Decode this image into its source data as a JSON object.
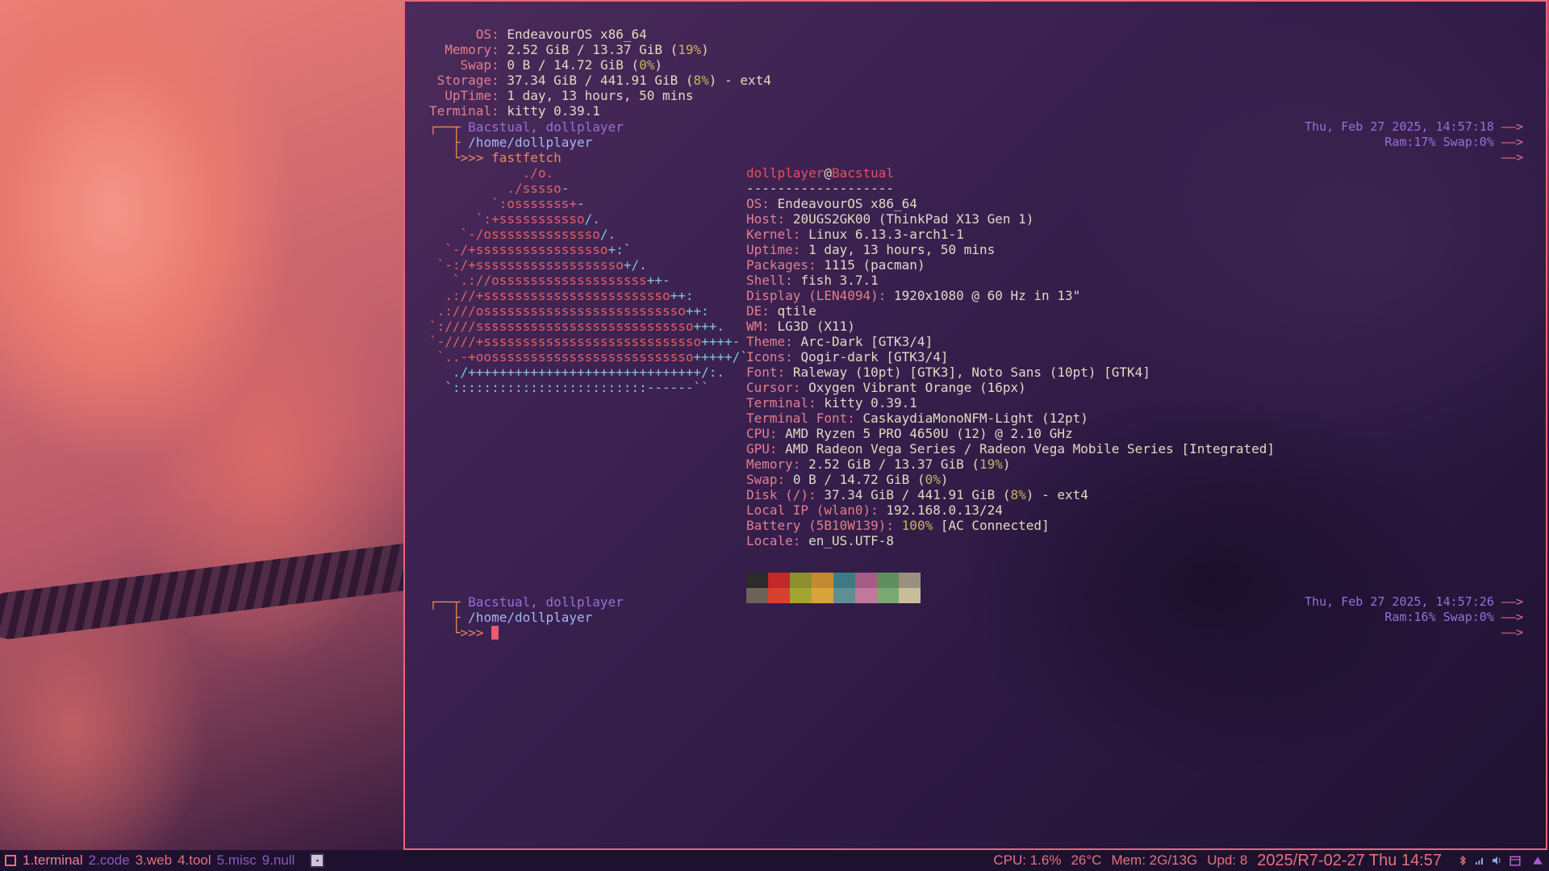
{
  "sysinfo_top": [
    {
      "label": "OS",
      "value": "EndeavourOS x86_64"
    },
    {
      "label": "Memory",
      "value_pre": "2.52 GiB / 13.37 GiB (",
      "value_pct": "19%",
      "value_post": ")"
    },
    {
      "label": "Swap",
      "value_pre": "0 B / 14.72 GiB (",
      "value_pct": "0%",
      "value_post": ")"
    },
    {
      "label": "Storage",
      "value_pre": "37.34 GiB / 441.91 GiB (",
      "value_pct": "8%",
      "value_post": ") - ext4"
    },
    {
      "label": "UpTime",
      "value": "1 day, 13 hours, 50 mins"
    },
    {
      "label": "Terminal",
      "value": "kitty 0.39.1"
    }
  ],
  "prompt1": {
    "user": "Bacstual, dollplayer",
    "path": "/home/dollplayer",
    "arrows": ">>>",
    "command": "fastfetch",
    "right_datetime": "Thu, Feb 27 2025, 14:57:18",
    "right_mem": "Ram:17% Swap:0%",
    "right_arrow": "——>"
  },
  "prompt2": {
    "user": "Bacstual, dollplayer",
    "path": "/home/dollplayer",
    "arrows": ">>>",
    "right_datetime": "Thu, Feb 27 2025, 14:57:26",
    "right_mem": "Ram:16% Swap:0%",
    "right_arrow": "——>"
  },
  "ascii_art": [
    {
      "red": "            ./o.",
      "blue": ""
    },
    {
      "red": "          ./sssso",
      "blue": "-"
    },
    {
      "red": "        `:osssssss+",
      "blue": "-"
    },
    {
      "red": "      `:+sssssssssso",
      "blue": "/."
    },
    {
      "red": "    `-/ossssssssssssso",
      "blue": "/."
    },
    {
      "red": "  `-/+sssssssssssssssso",
      "blue": "+:`"
    },
    {
      "red": " `-:/+sssssssssssssssssso",
      "blue": "+/."
    },
    {
      "red": "   `.://osssssssssssssssssss",
      "blue": "++-"
    },
    {
      "red": "  .://+ssssssssssssssssssssssso",
      "blue": "++:"
    },
    {
      "red": " .:///ossssssssssssssssssssssssso",
      "blue": "++:"
    },
    {
      "red": "`:////ssssssssssssssssssssssssssso",
      "blue": "+++."
    },
    {
      "red": "`-////+ssssssssssssssssssssssssssso",
      "blue": "++++-"
    },
    {
      "red": " `..-+oossssssssssssssssssssssssso",
      "blue": "+++++/`"
    },
    {
      "red": "",
      "blue": "   ./++++++++++++++++++++++++++++++/:."
    },
    {
      "red": "",
      "blue": "  `:::::::::::::::::::::::::------``"
    }
  ],
  "fetch": {
    "user": "dollplayer",
    "at": "@",
    "host": "Bacstual",
    "separator": "-------------------",
    "rows": [
      {
        "label": "OS",
        "value": "EndeavourOS x86_64"
      },
      {
        "label": "Host",
        "value": "20UGS2GK00 (ThinkPad X13 Gen 1)"
      },
      {
        "label": "Kernel",
        "value": "Linux 6.13.3-arch1-1"
      },
      {
        "label": "Uptime",
        "value": "1 day, 13 hours, 50 mins"
      },
      {
        "label": "Packages",
        "value": "1115 (pacman)"
      },
      {
        "label": "Shell",
        "value": "fish 3.7.1"
      },
      {
        "label": "Display (LEN4094)",
        "value": "1920x1080 @ 60 Hz in 13\""
      },
      {
        "label": "DE",
        "value": "qtile"
      },
      {
        "label": "WM",
        "value": "LG3D (X11)"
      },
      {
        "label": "Theme",
        "value": "Arc-Dark [GTK3/4]"
      },
      {
        "label": "Icons",
        "value": "Qogir-dark [GTK3/4]"
      },
      {
        "label": "Font",
        "value": "Raleway (10pt) [GTK3], Noto Sans (10pt) [GTK4]"
      },
      {
        "label": "Cursor",
        "value": "Oxygen Vibrant Orange (16px)"
      },
      {
        "label": "Terminal",
        "value": "kitty 0.39.1"
      },
      {
        "label": "Terminal Font",
        "value": "CaskaydiaMonoNFM-Light (12pt)"
      },
      {
        "label": "CPU",
        "value": "AMD Ryzen 5 PRO 4650U (12) @ 2.10 GHz"
      },
      {
        "label": "GPU",
        "value": "AMD Radeon Vega Series / Radeon Vega Mobile Series [Integrated]"
      },
      {
        "label": "Memory",
        "value_pre": "2.52 GiB / 13.37 GiB (",
        "value_pct": "19%",
        "value_post": ")"
      },
      {
        "label": "Swap",
        "value_pre": "0 B / 14.72 GiB (",
        "value_pct": "0%",
        "value_post": ")"
      },
      {
        "label": "Disk (/)",
        "value_pre": "37.34 GiB / 441.91 GiB (",
        "value_pct": "8%",
        "value_post": ") - ext4"
      },
      {
        "label": "Local IP (wlan0)",
        "value": "192.168.0.13/24"
      },
      {
        "label": "Battery (5B10W139)",
        "value_pct": "100%",
        "value_post": " [AC Connected]"
      },
      {
        "label": "Locale",
        "value": "en_US.UTF-8"
      }
    ],
    "palette_top": [
      "#2b2b2b",
      "#c4262a",
      "#8c8f2a",
      "#c5892e",
      "#3d7a83",
      "#a55c84",
      "#5f8f5f",
      "#9a9080"
    ],
    "palette_bottom": [
      "#6b6358",
      "#d8402f",
      "#a3a432",
      "#d9a53b",
      "#5f8f93",
      "#c0789c",
      "#79a972",
      "#c9bc9b"
    ]
  },
  "bar": {
    "workspaces": [
      {
        "label": "1.terminal",
        "state": "active"
      },
      {
        "label": "2.code",
        "state": "dim"
      },
      {
        "label": "3.web",
        "state": "normal"
      },
      {
        "label": "4.tool",
        "state": "normal"
      },
      {
        "label": "5.misc",
        "state": "dim"
      },
      {
        "label": "9.null",
        "state": "dim"
      }
    ],
    "cpu": "CPU: 1.6%",
    "temp": "26°C",
    "mem": "Mem: 2G/13G",
    "upd": "Upd: 8",
    "clock": "2025/R7-02-27 Thu 14:57"
  }
}
